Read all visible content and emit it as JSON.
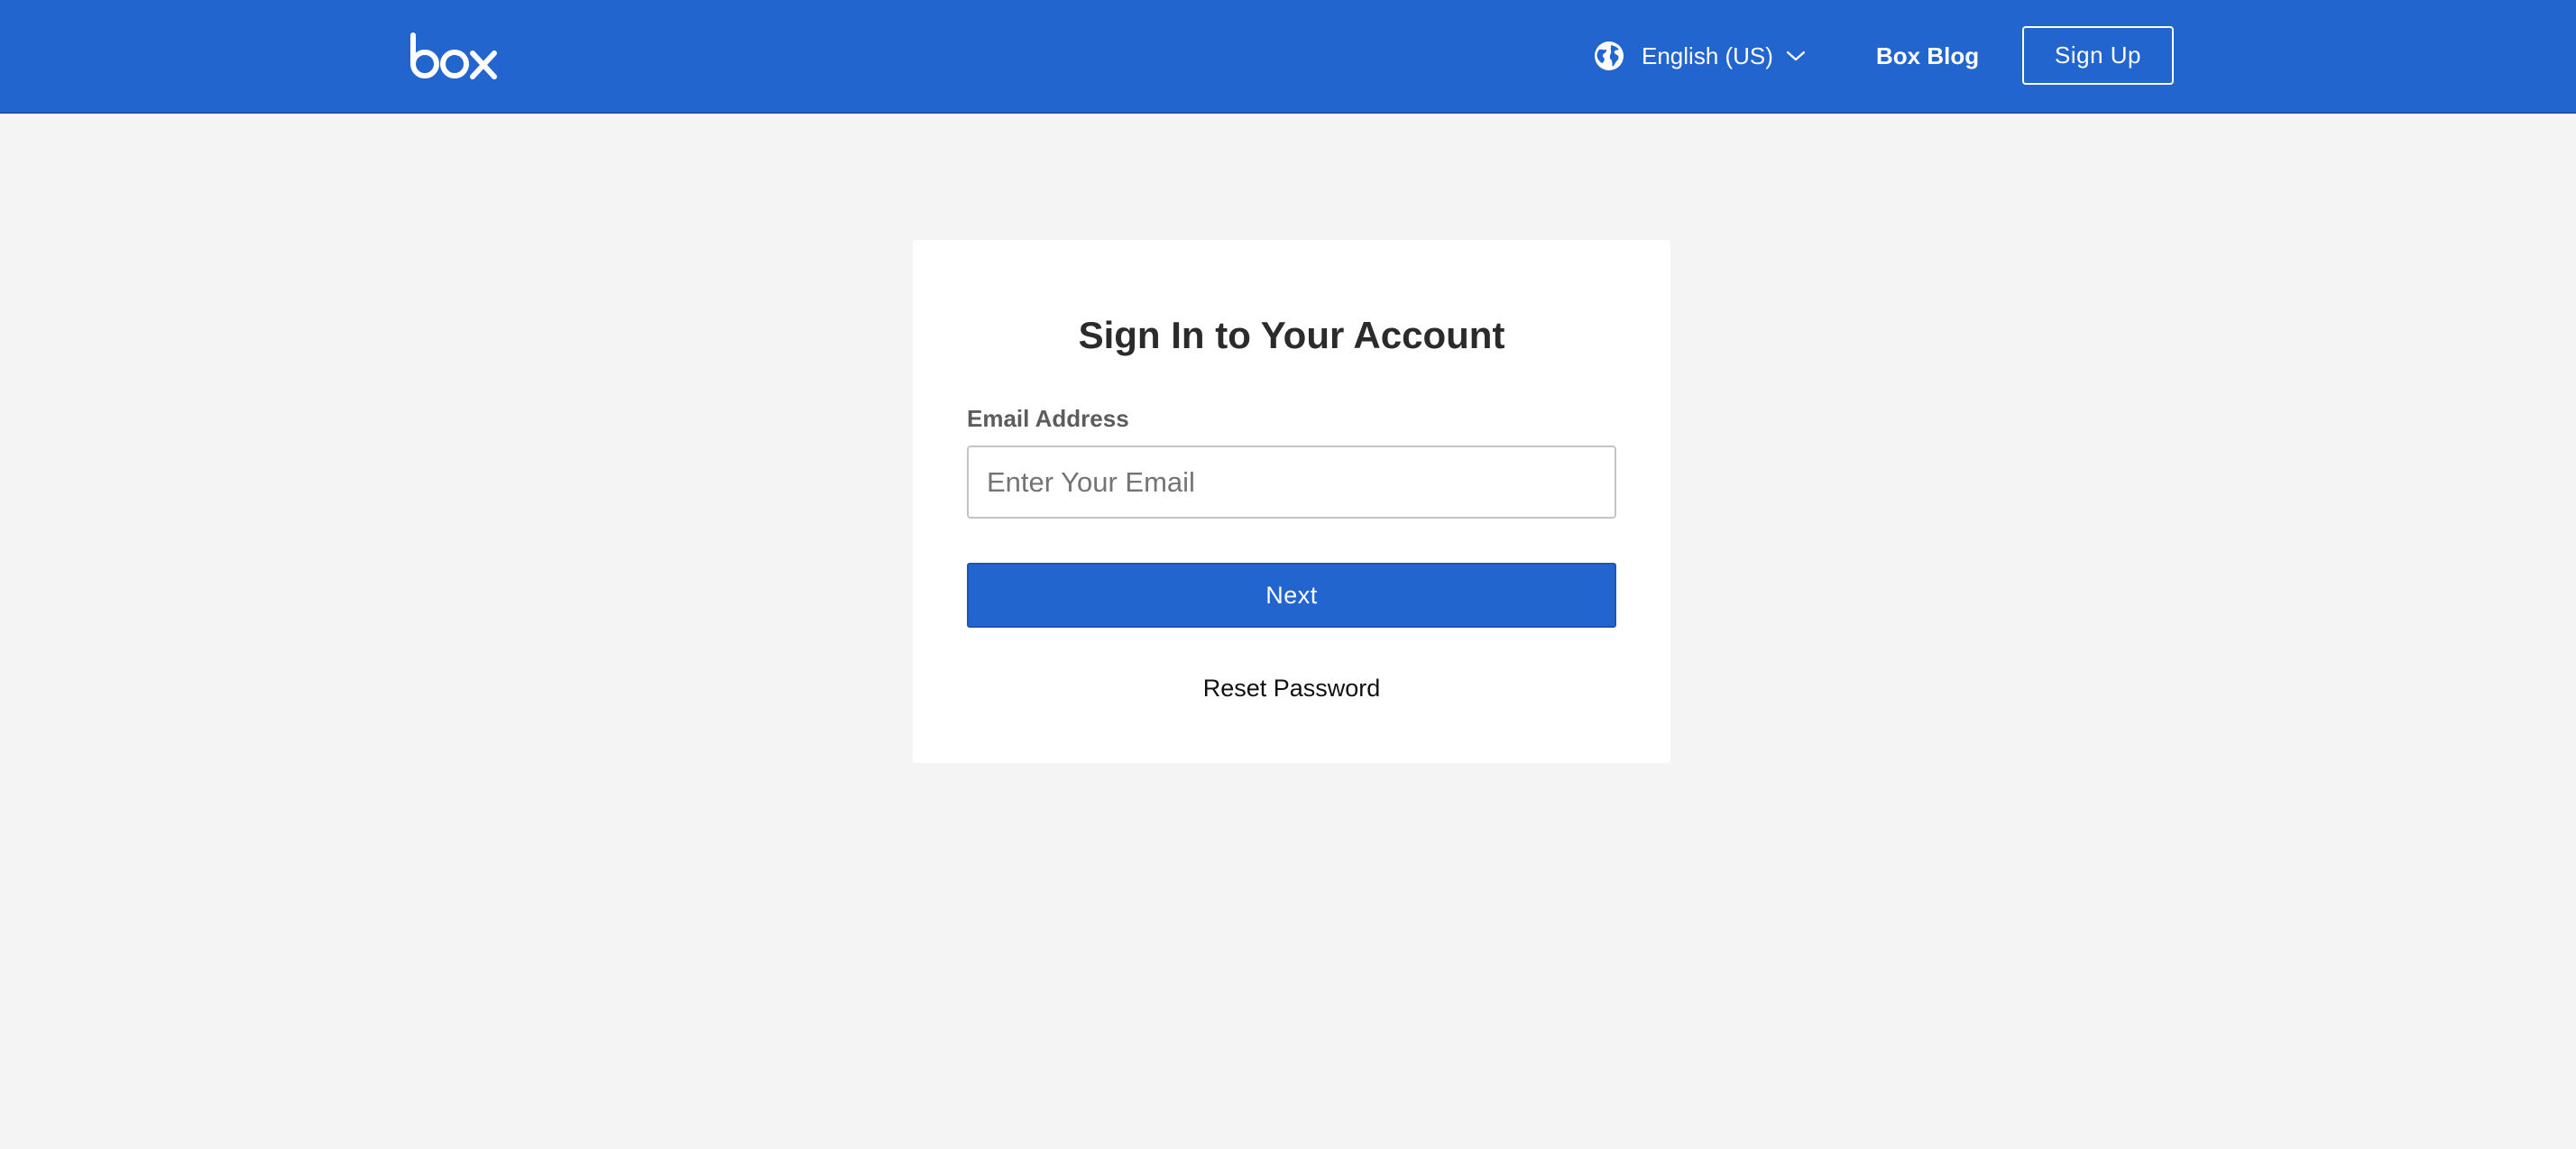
{
  "header": {
    "logo_text": "box",
    "language": {
      "label": "English (US)",
      "icon": "globe-icon",
      "dropdown_icon": "chevron-down-icon"
    },
    "blog_link": "Box Blog",
    "signup_button": "Sign Up",
    "background_color": "#2365cf"
  },
  "signin_card": {
    "title": "Sign In to Your Account",
    "email_label": "Email Address",
    "email_input": {
      "value": "",
      "placeholder": "Enter Your Email"
    },
    "next_button": "Next",
    "reset_password_link": "Reset Password"
  },
  "colors": {
    "brand_blue": "#2365cf",
    "page_background": "#f4f4f4",
    "card_background": "#ffffff"
  }
}
